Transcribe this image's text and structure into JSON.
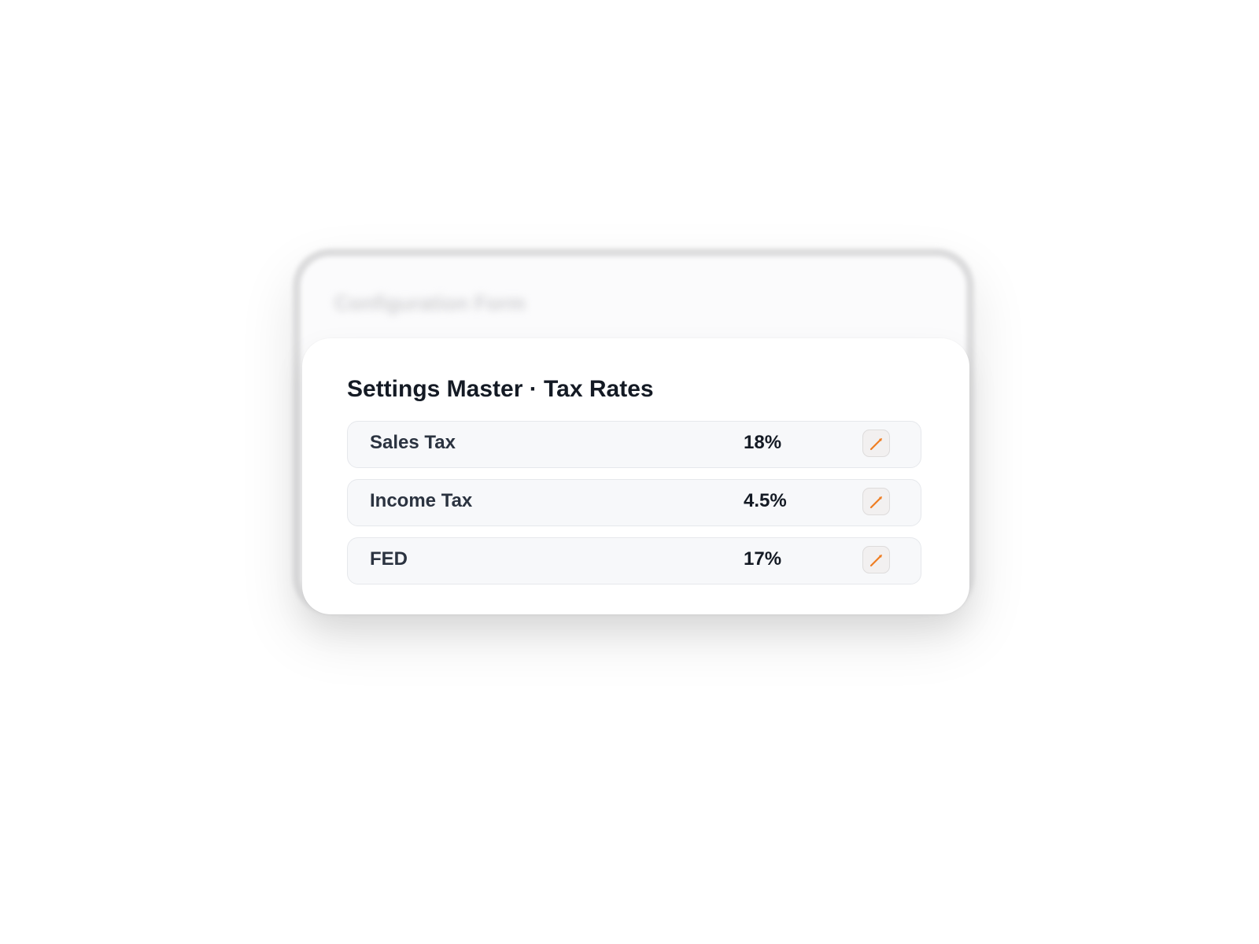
{
  "background_window": {
    "title": "Configuration Form"
  },
  "card": {
    "title": "Settings Master · Tax Rates",
    "rows": [
      {
        "label": "Sales Tax",
        "value": "18%",
        "edit_icon": "pencil-icon"
      },
      {
        "label": "Income Tax",
        "value": "4.5%",
        "edit_icon": "pencil-icon"
      },
      {
        "label": "FED",
        "value": "17%",
        "edit_icon": "pencil-icon"
      }
    ]
  },
  "colors": {
    "accent": "#ef7d22",
    "title_text": "#141a24",
    "label_text": "#2b3340",
    "row_background": "#f7f8fa"
  }
}
